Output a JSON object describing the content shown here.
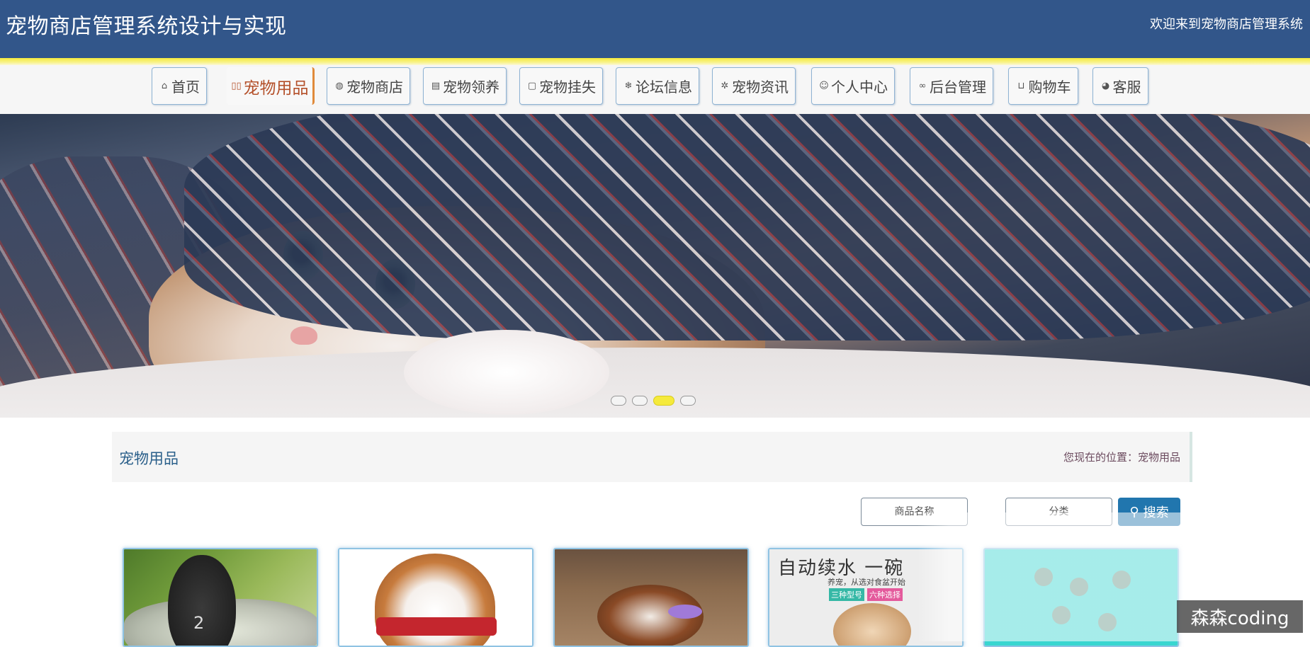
{
  "header": {
    "site_title": "宠物商店管理系统设计与实现",
    "welcome": "欢迎来到宠物商店管理系统"
  },
  "nav": {
    "items": [
      {
        "label": "首页",
        "icon": "home-icon"
      },
      {
        "label": "宠物用品",
        "icon": "goods-icon"
      },
      {
        "label": "宠物商店",
        "icon": "globe-icon"
      },
      {
        "label": "宠物领养",
        "icon": "document-icon"
      },
      {
        "label": "宠物挂失",
        "icon": "note-icon"
      },
      {
        "label": "论坛信息",
        "icon": "snowflake-icon"
      },
      {
        "label": "宠物资讯",
        "icon": "badge-icon"
      },
      {
        "label": "个人中心",
        "icon": "user-icon"
      },
      {
        "label": "后台管理",
        "icon": "link-icon"
      },
      {
        "label": "购物车",
        "icon": "cart-icon"
      },
      {
        "label": "客服",
        "icon": "chat-icon"
      }
    ],
    "active": "宠物用品"
  },
  "carousel": {
    "slide_count": 4,
    "active_index": 3
  },
  "section": {
    "title": "宠物用品",
    "breadcrumb_prefix": "您现在的位置：",
    "breadcrumb_current": "宠物用品"
  },
  "search": {
    "name_placeholder": "商品名称",
    "category_placeholder": "分类",
    "button_label": "搜索"
  },
  "products": {
    "card4_heading": "自动续水 一碗",
    "card4_subtitle": "养宠，从选对食盆开始",
    "card4_tag1": "三种型号",
    "card4_tag2": "六种选择",
    "card1_sole_number": "2"
  },
  "watermark": "森森coding",
  "colors": {
    "header_bg": "#32568a",
    "accent_yellow": "#f5ea3c",
    "active_nav": "#b4502a",
    "search_button": "#2176ae"
  }
}
